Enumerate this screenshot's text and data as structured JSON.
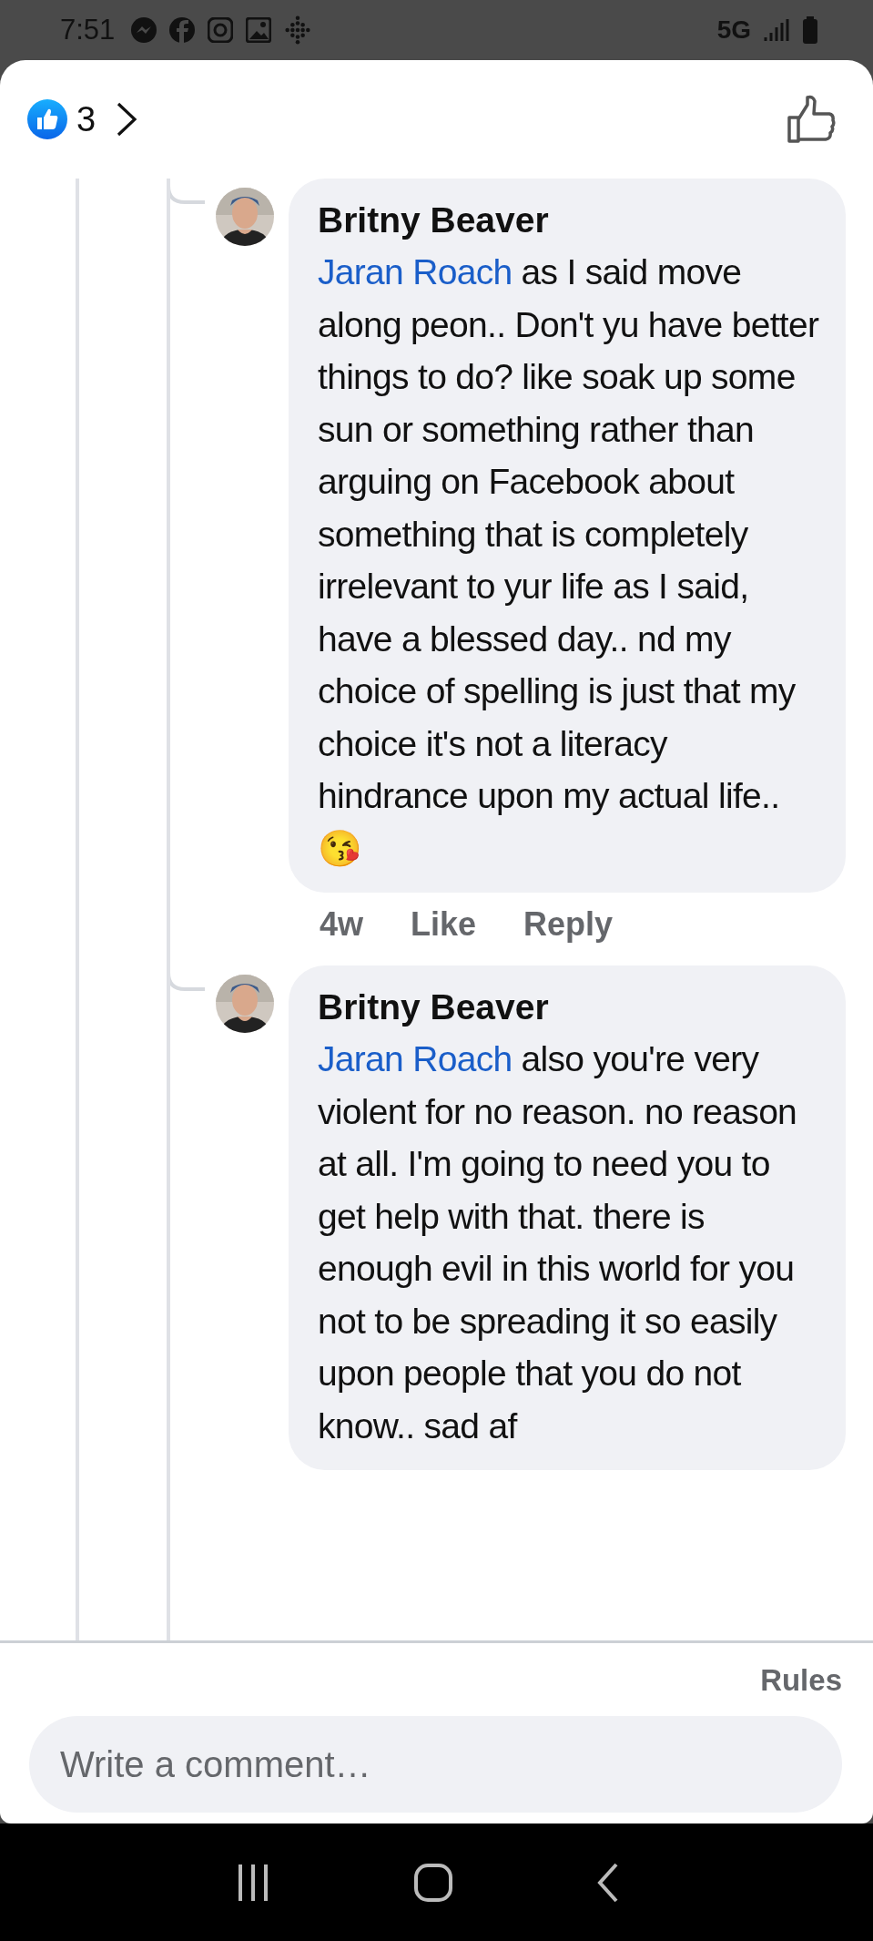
{
  "status_bar": {
    "time": "7:51",
    "network": "5G"
  },
  "header": {
    "reaction_count": "3"
  },
  "comments": [
    {
      "author": "Britny Beaver",
      "mention": "Jaran Roach",
      "text": " as I said move along peon.. Don't yu have better things to do? like soak up some sun or something rather than arguing on Facebook about something that is completely irrelevant to yur life as I said, have a blessed day.. nd my choice of spelling is just that my choice it's not a literacy hindrance upon my actual life.. 😘",
      "meta": [
        "4w",
        "Like",
        "Reply"
      ]
    },
    {
      "author": "Britny Beaver",
      "mention": "Jaran Roach",
      "text": " also you're very violent for no reason. no reason at all. I'm going to need you to get help with that. there is enough evil in this world for you not to be spreading it so easily upon people that you do not know.. sad af"
    }
  ],
  "footer": {
    "rules": "Rules",
    "placeholder": "Write a comment…"
  }
}
